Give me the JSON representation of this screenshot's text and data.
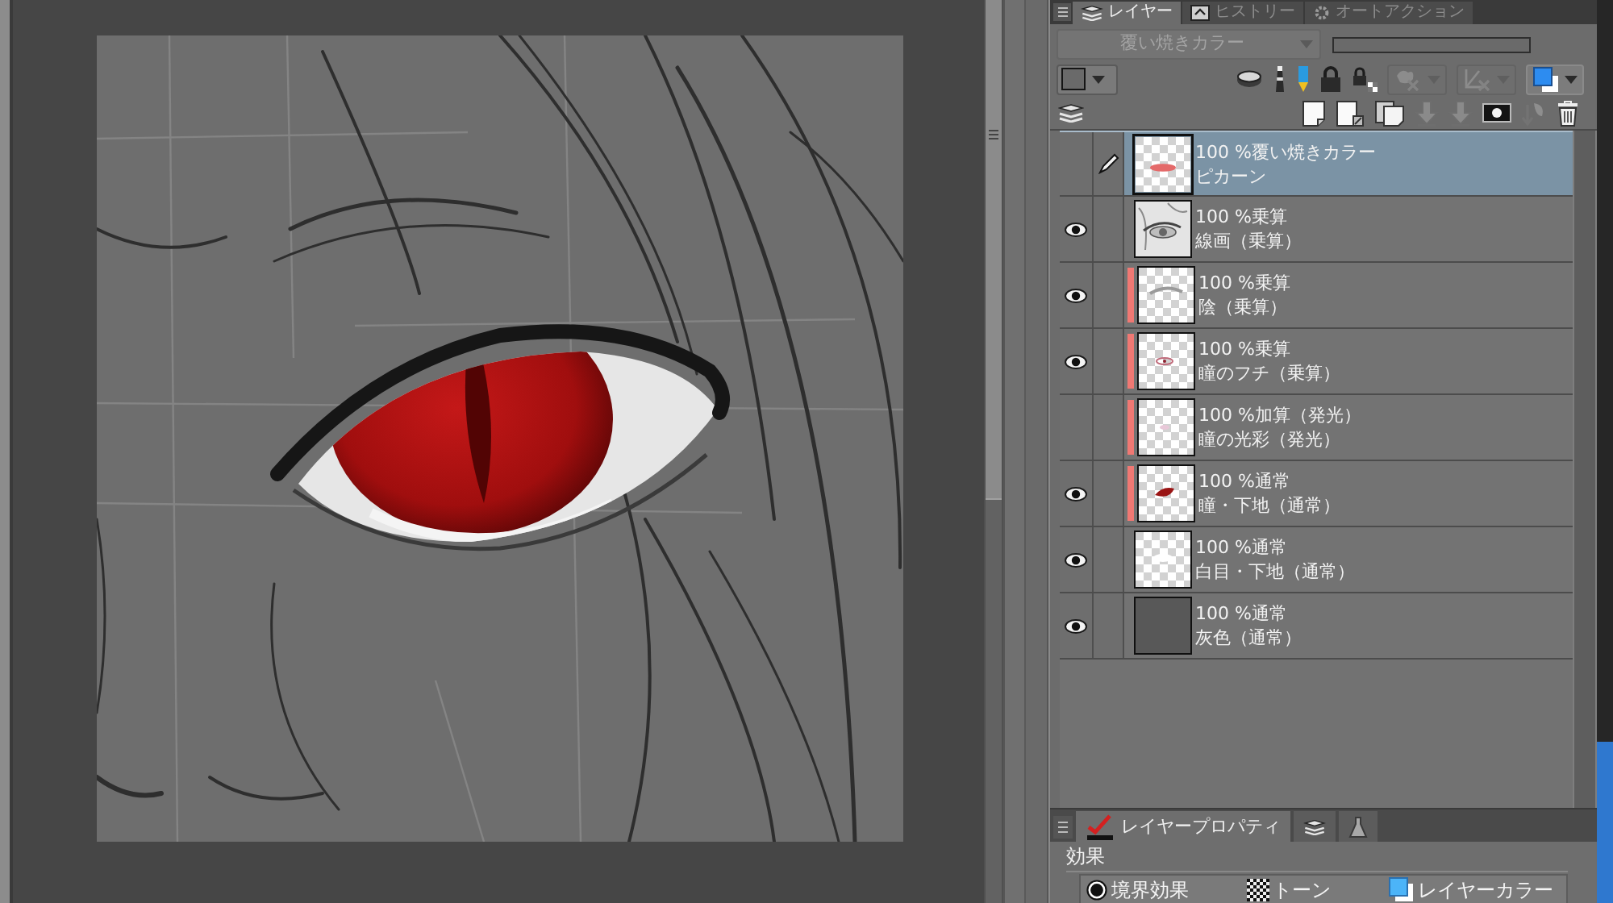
{
  "panel_tabs": [
    {
      "kind": "layers",
      "label": "レイヤー",
      "selected": true
    },
    {
      "kind": "history",
      "label": "ヒストリー",
      "selected": false
    },
    {
      "kind": "actions",
      "label": "オートアクション",
      "selected": false
    }
  ],
  "blend_mode": {
    "value": "覆い焼きカラー",
    "disabled": true
  },
  "tools": [
    {
      "kind": "clip",
      "disabled": false
    },
    {
      "kind": "reference",
      "disabled": false
    },
    {
      "kind": "draft",
      "disabled": false
    },
    {
      "kind": "lock",
      "disabled": false
    },
    {
      "kind": "lock-alpha",
      "disabled": false
    },
    {
      "kind": "target-blob",
      "disabled": true
    },
    {
      "kind": "target-ruler",
      "disabled": true
    },
    {
      "kind": "layer-color",
      "disabled": false
    }
  ],
  "layer_actions": [
    {
      "kind": "new-raster",
      "disabled": false
    },
    {
      "kind": "new-vector",
      "disabled": false
    },
    {
      "kind": "new-folder",
      "disabled": false
    },
    {
      "kind": "transfer-down",
      "disabled": true
    },
    {
      "kind": "merge-down",
      "disabled": true
    },
    {
      "kind": "mask",
      "disabled": false
    },
    {
      "kind": "apply-mask",
      "disabled": true
    },
    {
      "kind": "delete",
      "disabled": false
    }
  ],
  "layers": [
    {
      "blend": "100 %覆い焼きカラー",
      "name": "ピカーン",
      "visible": false,
      "editing": true,
      "clipped": false,
      "selected": true,
      "thumbnail": {
        "kind": "transparent"
      }
    },
    {
      "blend": "100 %乗算",
      "name": "線画（乗算）",
      "visible": true,
      "editing": false,
      "clipped": false,
      "selected": false,
      "thumbnail": {
        "kind": "sketch"
      }
    },
    {
      "blend": "100 %乗算",
      "name": "陰（乗算）",
      "visible": true,
      "editing": false,
      "clipped": true,
      "selected": false,
      "thumbnail": {
        "kind": "transparent"
      }
    },
    {
      "blend": "100 %乗算",
      "name": "瞳のフチ（乗算）",
      "visible": true,
      "editing": false,
      "clipped": true,
      "selected": false,
      "thumbnail": {
        "kind": "transparent"
      }
    },
    {
      "blend": "100 %加算（発光）",
      "name": "瞳の光彩（発光）",
      "visible": false,
      "editing": false,
      "clipped": true,
      "selected": false,
      "thumbnail": {
        "kind": "transparent"
      }
    },
    {
      "blend": "100 %通常",
      "name": "瞳・下地（通常）",
      "visible": true,
      "editing": false,
      "clipped": true,
      "selected": false,
      "thumbnail": {
        "kind": "transparent"
      }
    },
    {
      "blend": "100 %通常",
      "name": "白目・下地（通常）",
      "visible": true,
      "editing": false,
      "clipped": false,
      "selected": false,
      "thumbnail": {
        "kind": "transparent"
      }
    },
    {
      "blend": "100 %通常",
      "name": "灰色（通常）",
      "visible": true,
      "editing": false,
      "clipped": false,
      "selected": false,
      "thumbnail": {
        "kind": "solid"
      }
    }
  ],
  "properties": {
    "tabs": [
      {
        "kind": "check",
        "label": "レイヤープロパティ",
        "selected": true
      },
      {
        "kind": "layers",
        "selected": false
      },
      {
        "kind": "flask",
        "selected": false
      }
    ],
    "heading": "効果",
    "effects": [
      {
        "kind": "border",
        "label": "境界効果"
      },
      {
        "kind": "tone",
        "label": "トーン"
      },
      {
        "kind": "color",
        "label": "レイヤーカラー"
      }
    ]
  }
}
